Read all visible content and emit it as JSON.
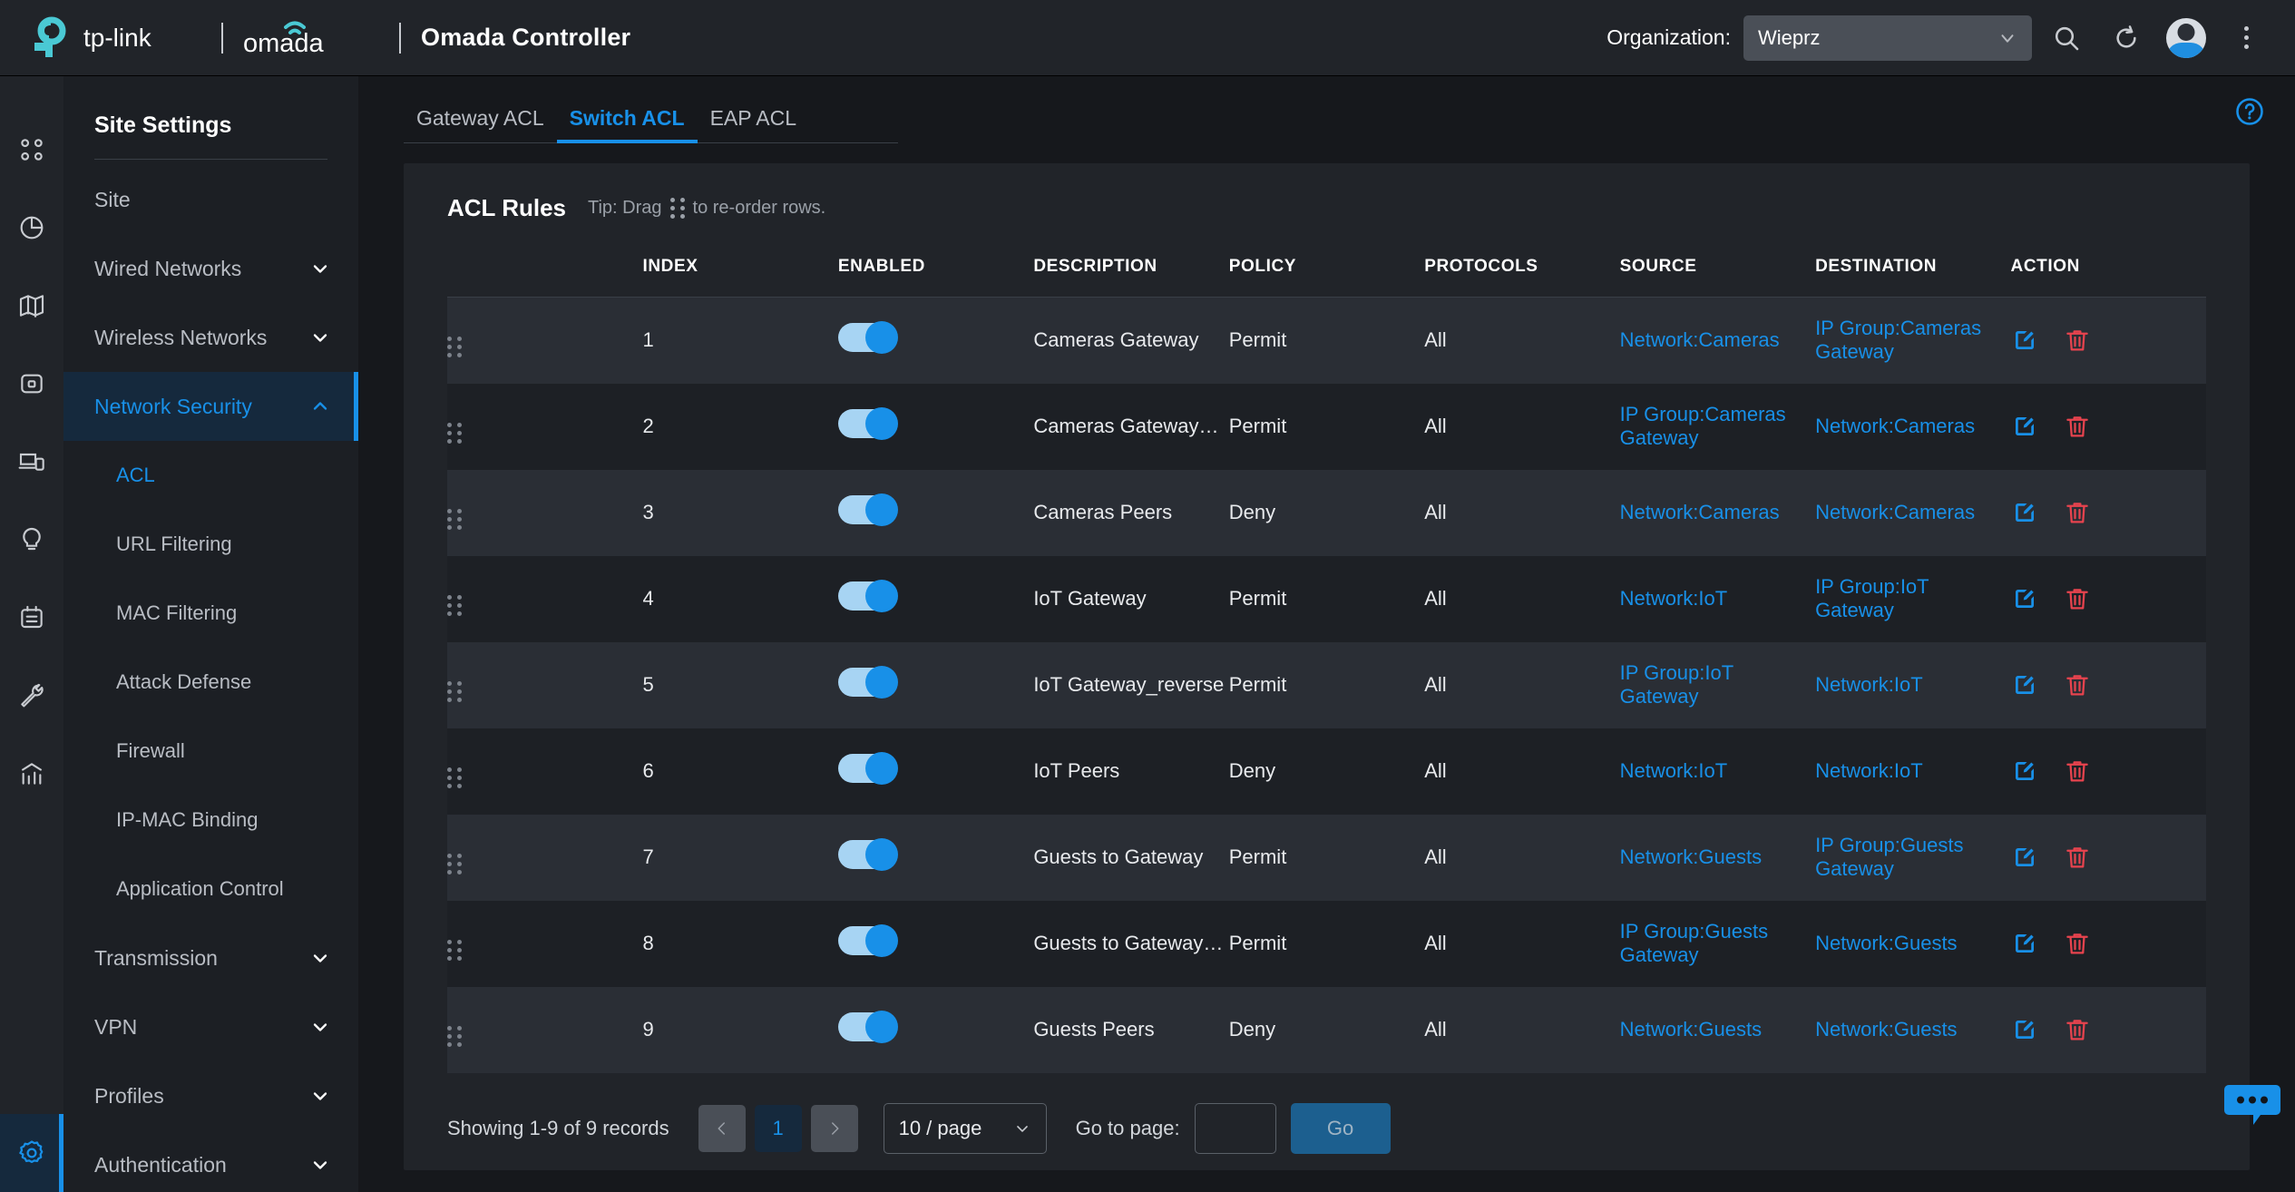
{
  "header": {
    "brand_tplink": "tp-link",
    "brand_omada": "omada",
    "app_title": "Omada Controller",
    "organization_label": "Organization:",
    "organization_value": "Wieprz",
    "icons": [
      "search-icon",
      "refresh-icon",
      "avatar",
      "more-vertical-icon"
    ]
  },
  "rail": {
    "items": [
      {
        "name": "dashboard-icon"
      },
      {
        "name": "statistics-pie-icon"
      },
      {
        "name": "map-icon"
      },
      {
        "name": "device-icon"
      },
      {
        "name": "clients-icon"
      },
      {
        "name": "insight-icon"
      },
      {
        "name": "log-icon"
      },
      {
        "name": "tools-icon"
      },
      {
        "name": "report-icon"
      },
      {
        "name": "settings-gear-icon"
      }
    ],
    "active": "settings-gear-icon"
  },
  "sidebar": {
    "title": "Site Settings",
    "items": [
      {
        "label": "Site",
        "type": "link",
        "active": false
      },
      {
        "label": "Wired Networks",
        "type": "group",
        "expanded": false,
        "chevron": "down"
      },
      {
        "label": "Wireless Networks",
        "type": "group",
        "expanded": false,
        "chevron": "down"
      },
      {
        "label": "Network Security",
        "type": "group",
        "expanded": true,
        "chevron": "up",
        "active": true
      },
      {
        "label": "ACL",
        "type": "sub",
        "active": true
      },
      {
        "label": "URL Filtering",
        "type": "sub",
        "active": false
      },
      {
        "label": "MAC Filtering",
        "type": "sub",
        "active": false
      },
      {
        "label": "Attack Defense",
        "type": "sub",
        "active": false
      },
      {
        "label": "Firewall",
        "type": "sub",
        "active": false
      },
      {
        "label": "IP-MAC Binding",
        "type": "sub",
        "active": false
      },
      {
        "label": "Application Control",
        "type": "sub",
        "active": false
      },
      {
        "label": "Transmission",
        "type": "group",
        "expanded": false,
        "chevron": "down"
      },
      {
        "label": "VPN",
        "type": "group",
        "expanded": false,
        "chevron": "down"
      },
      {
        "label": "Profiles",
        "type": "group",
        "expanded": false,
        "chevron": "down"
      },
      {
        "label": "Authentication",
        "type": "group",
        "expanded": false,
        "chevron": "down"
      }
    ]
  },
  "tabs": [
    {
      "label": "Gateway ACL",
      "active": false
    },
    {
      "label": "Switch ACL",
      "active": true
    },
    {
      "label": "EAP ACL",
      "active": false
    }
  ],
  "panel": {
    "title": "ACL Rules",
    "tip_before": "Tip: Drag",
    "tip_after": "to re-order rows."
  },
  "table": {
    "columns": [
      "INDEX",
      "ENABLED",
      "DESCRIPTION",
      "POLICY",
      "PROTOCOLS",
      "SOURCE",
      "DESTINATION",
      "ACTION"
    ],
    "rows": [
      {
        "index": "1",
        "enabled": true,
        "description": "Cameras Gateway",
        "policy": "Permit",
        "protocols": "All",
        "source": "Network:Cameras",
        "destination": "IP Group:Cameras Gateway"
      },
      {
        "index": "2",
        "enabled": true,
        "description": "Cameras Gateway_rev...",
        "policy": "Permit",
        "protocols": "All",
        "source": "IP Group:Cameras Gateway",
        "destination": "Network:Cameras"
      },
      {
        "index": "3",
        "enabled": true,
        "description": "Cameras Peers",
        "policy": "Deny",
        "protocols": "All",
        "source": "Network:Cameras",
        "destination": "Network:Cameras"
      },
      {
        "index": "4",
        "enabled": true,
        "description": "IoT Gateway",
        "policy": "Permit",
        "protocols": "All",
        "source": "Network:IoT",
        "destination": "IP Group:IoT Gateway"
      },
      {
        "index": "5",
        "enabled": true,
        "description": "IoT Gateway_reverse",
        "policy": "Permit",
        "protocols": "All",
        "source": "IP Group:IoT Gateway",
        "destination": "Network:IoT"
      },
      {
        "index": "6",
        "enabled": true,
        "description": "IoT Peers",
        "policy": "Deny",
        "protocols": "All",
        "source": "Network:IoT",
        "destination": "Network:IoT"
      },
      {
        "index": "7",
        "enabled": true,
        "description": "Guests to Gateway",
        "policy": "Permit",
        "protocols": "All",
        "source": "Network:Guests",
        "destination": "IP Group:Guests Gateway"
      },
      {
        "index": "8",
        "enabled": true,
        "description": "Guests to Gateway_rev...",
        "policy": "Permit",
        "protocols": "All",
        "source": "IP Group:Guests Gateway",
        "destination": "Network:Guests"
      },
      {
        "index": "9",
        "enabled": true,
        "description": "Guests Peers",
        "policy": "Deny",
        "protocols": "All",
        "source": "Network:Guests",
        "destination": "Network:Guests"
      }
    ],
    "action_icons": [
      "edit-icon",
      "delete-icon"
    ]
  },
  "footer": {
    "records": "Showing 1-9 of 9 records",
    "prev": "‹",
    "page_number": "1",
    "next": "›",
    "page_size": "10 / page",
    "goto_label": "Go to page:",
    "goto_value": "",
    "go_label": "Go"
  },
  "colors": {
    "accent": "#1890e8",
    "delete": "#e8434e",
    "brand_cyan": "#4ac9d4",
    "row_odd": "#2a2e35",
    "row_even": "#1d2025"
  }
}
